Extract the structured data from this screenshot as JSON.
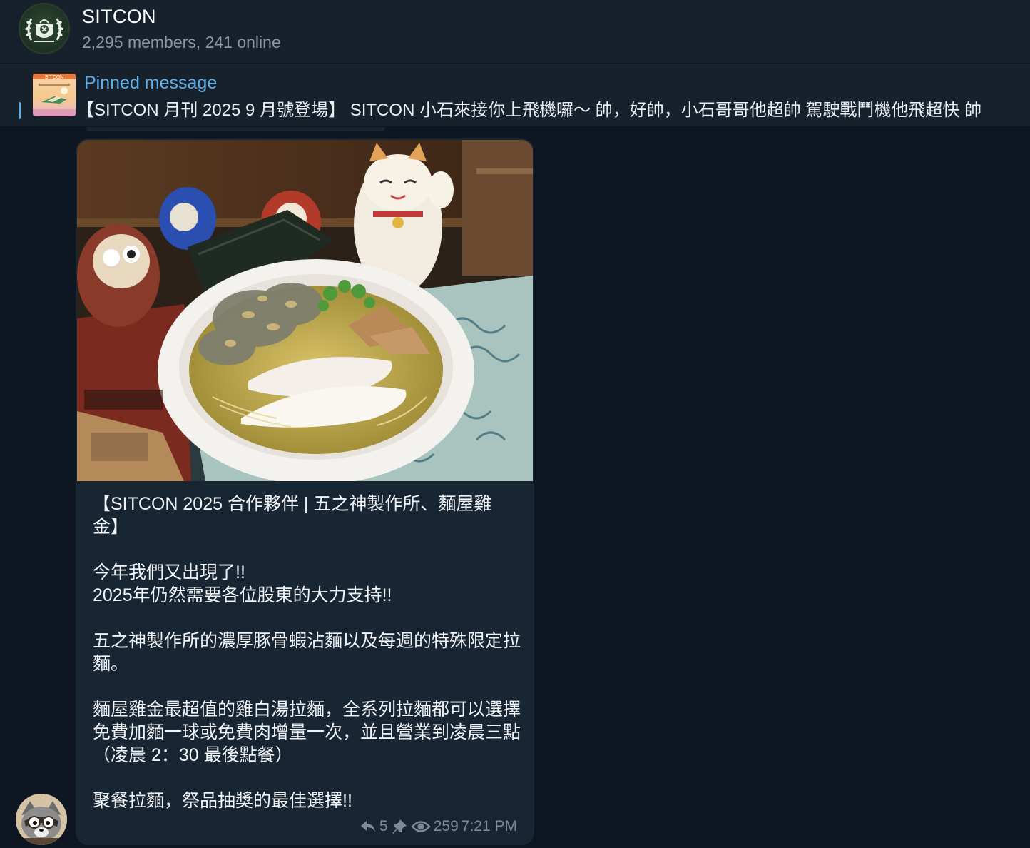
{
  "header": {
    "title": "SITCON",
    "subtitle": "2,295 members, 241 online",
    "avatar_icon": "sitcon-laurel-logo"
  },
  "pinned": {
    "label": "Pinned message",
    "text": "【SITCON 月刊 2025 9 月號登場】 SITCON 小石來接你上飛機囉～ 帥，好帥，小石哥哥他超帥 駕駛戰鬥機他飛超快 帥",
    "thumb_label": "SITCON"
  },
  "message": {
    "photo_icon": "ramen-photo",
    "text": "【SITCON 2025 合作夥伴 | 五之神製作所、麵屋雞金】\n\n今年我們又出現了!!\n2025年仍然需要各位股東的大力支持!!\n\n五之神製作所的濃厚豚骨蝦沾麵以及每週的特殊限定拉麵。\n\n麵屋雞金最超值的雞白湯拉麵，全系列拉麵都可以選擇免費加麵一球或免費肉增量一次，並且營業到凌晨三點（凌晨 2：30 最後點餐）\n\n聚餐拉麵，祭品抽獎的最佳選擇!!",
    "replies": "5",
    "views": "259",
    "time": "7:21 PM",
    "icons": [
      "reply-icon",
      "pin-icon",
      "eye-icon"
    ]
  },
  "sender": {
    "avatar_icon": "raccoon-avatar"
  },
  "colors": {
    "background": "#0e1621",
    "header": "#17212b",
    "bubble": "#182533",
    "accent": "#5eaee8",
    "muted": "#7d8b99"
  }
}
